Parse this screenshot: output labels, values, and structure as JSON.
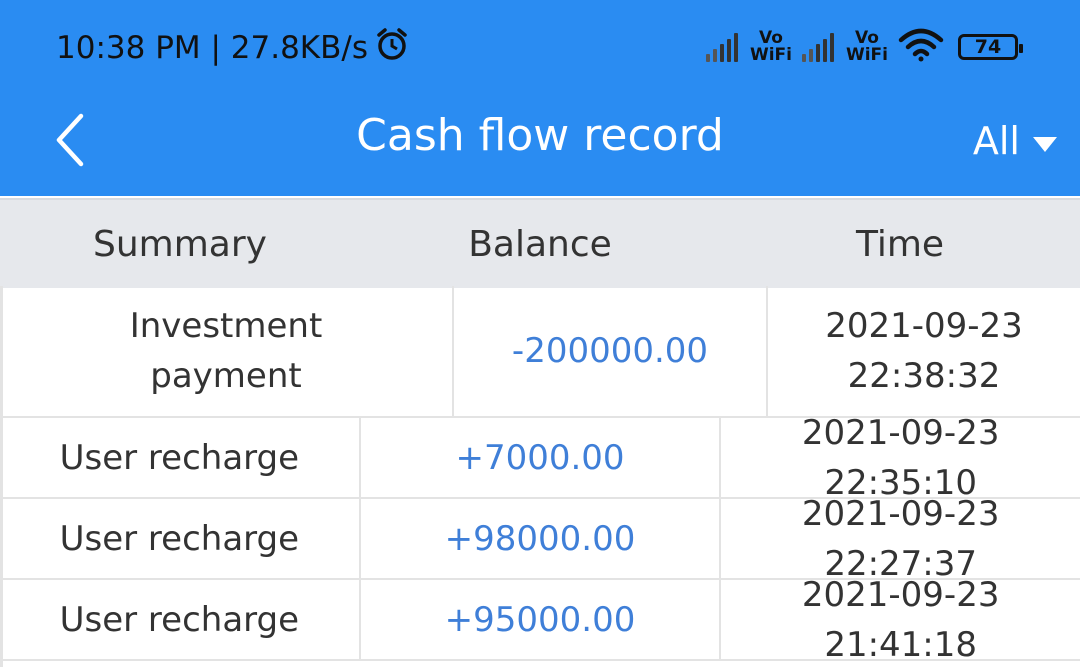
{
  "status_bar": {
    "time_speed": "10:38 PM | 27.8KB/s",
    "vowifi_1_top": "Vo",
    "vowifi_1_bottom": "WiFi",
    "vowifi_2_top": "Vo",
    "vowifi_2_bottom": "WiFi",
    "battery": "74"
  },
  "header": {
    "title": "Cash flow record",
    "filter_label": "All",
    "colors": {
      "background": "#2a8cf2",
      "text": "#ffffff"
    }
  },
  "table": {
    "columns": [
      "Summary",
      "Balance",
      "Time"
    ],
    "rows": [
      {
        "summary": "Investment payment",
        "balance": "-200000.00",
        "time": "2021-09-23 22:38:32"
      },
      {
        "summary": "User recharge",
        "balance": "+7000.00",
        "time": "2021-09-23 22:35:10"
      },
      {
        "summary": "User recharge",
        "balance": "+98000.00",
        "time": "2021-09-23 22:27:37"
      },
      {
        "summary": "User recharge",
        "balance": "+95000.00",
        "time": "2021-09-23 21:41:18"
      }
    ],
    "colors": {
      "amount": "#3f7fd8",
      "header_bg": "#e6e8ec"
    }
  }
}
